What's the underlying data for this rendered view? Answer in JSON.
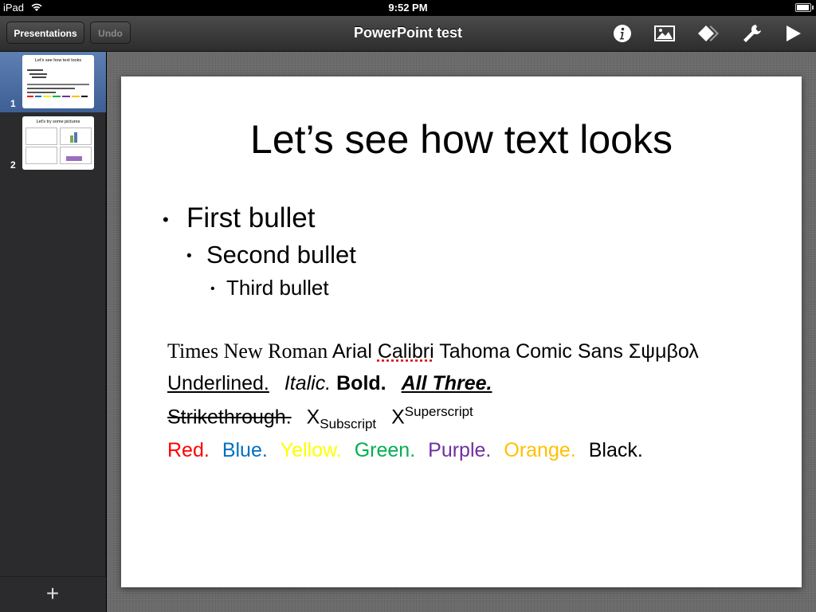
{
  "status_bar": {
    "device": "iPad",
    "time": "9:52 PM"
  },
  "toolbar": {
    "presentations_label": "Presentations",
    "undo_label": "Undo",
    "document_title": "PowerPoint test",
    "icons": [
      "info-icon",
      "media-icon",
      "animation-icon",
      "tools-icon",
      "play-icon"
    ]
  },
  "sidebar": {
    "slides": [
      {
        "number": "1",
        "thumb_title": "Let's see how text looks"
      },
      {
        "number": "2",
        "thumb_title": "Let's try some pictures"
      }
    ],
    "add_label": "+"
  },
  "slide": {
    "title": "Let’s see how text looks",
    "bullets": [
      "First bullet",
      "Second bullet",
      "Third bullet"
    ],
    "fonts": {
      "times": "Times New Roman",
      "arial": "Arial",
      "calibri": "Calibri",
      "tahoma": "Tahoma",
      "comic": "Comic Sans",
      "symbol": "Σψμβολ"
    },
    "styles": {
      "underlined": "Underlined.",
      "italic": "Italic.",
      "bold": "Bold.",
      "all_three": "All Three."
    },
    "strikethrough": "Strikethrough.",
    "x1": "X",
    "subscript": "Subscript",
    "x2": "X",
    "superscript": "Superscript",
    "colors": [
      {
        "label": "Red.",
        "color": "#ff0000"
      },
      {
        "label": "Blue.",
        "color": "#0070c0"
      },
      {
        "label": "Yellow.",
        "color": "#ffff00"
      },
      {
        "label": "Green.",
        "color": "#00b050"
      },
      {
        "label": "Purple.",
        "color": "#7030a0"
      },
      {
        "label": "Orange.",
        "color": "#ffc000"
      },
      {
        "label": "Black.",
        "color": "#000000"
      }
    ]
  }
}
